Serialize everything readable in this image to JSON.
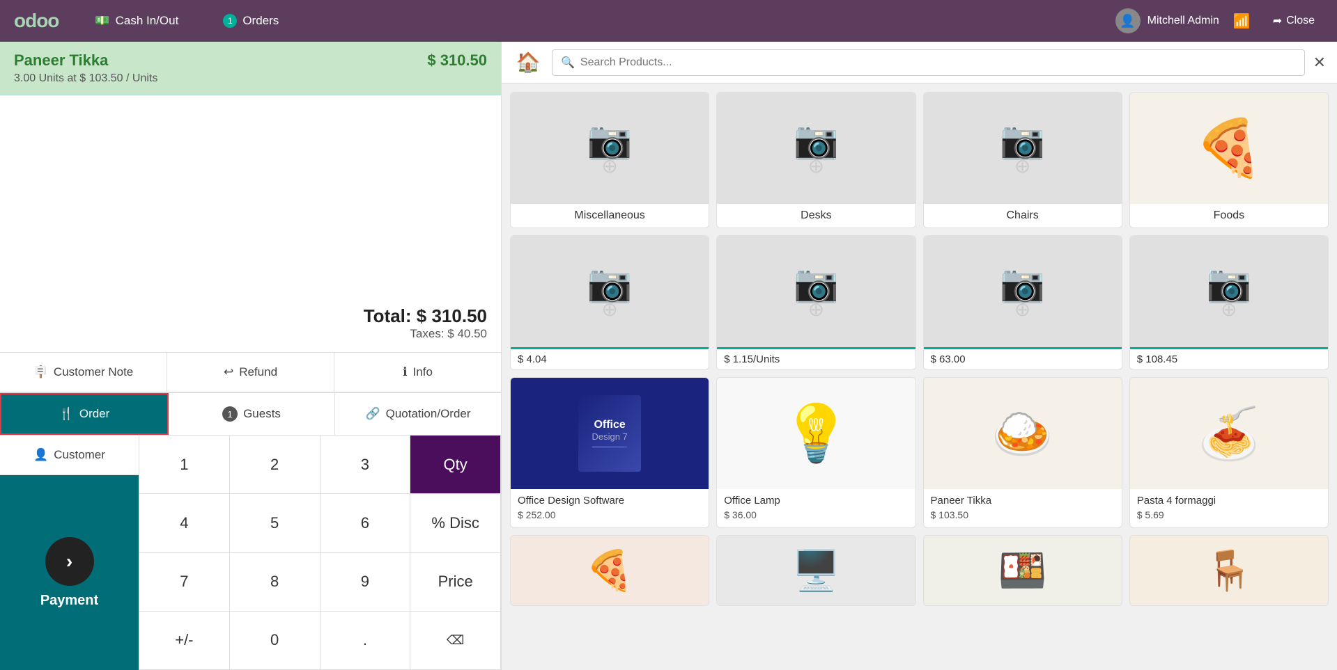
{
  "nav": {
    "logo": "odoo",
    "cash_in_out": "Cash In/Out",
    "orders": "Orders",
    "orders_badge": "1",
    "user": "Mitchell Admin",
    "close": "Close"
  },
  "order": {
    "item_name": "Paneer Tikka",
    "item_price": "$ 310.50",
    "item_detail": "3.00 Units at $ 103.50 / Units",
    "total_label": "Total: $ 310.50",
    "taxes_label": "Taxes: $ 40.50"
  },
  "action_buttons": [
    {
      "label": "Customer Note",
      "icon": "🪧"
    },
    {
      "label": "Refund",
      "icon": "↩"
    },
    {
      "label": "Info",
      "icon": "ℹ"
    }
  ],
  "order_actions": [
    {
      "label": "Order",
      "icon": "🍴",
      "active": true
    },
    {
      "label": "Guests",
      "icon": "1",
      "badge": true
    },
    {
      "label": "Quotation/Order",
      "icon": "🔗"
    }
  ],
  "customer_btn": "Customer",
  "payment_label": "Payment",
  "numpad": {
    "keys": [
      "1",
      "2",
      "3",
      "Qty",
      "4",
      "5",
      "6",
      "% Disc",
      "7",
      "8",
      "9",
      "Price",
      "+/-",
      "0",
      ".",
      "⌫"
    ],
    "active": "Qty"
  },
  "search": {
    "placeholder": "Search Products...",
    "home_icon": "🏠"
  },
  "categories": [
    {
      "name": "Miscellaneous",
      "has_image": false
    },
    {
      "name": "Desks",
      "has_image": false
    },
    {
      "name": "Chairs",
      "has_image": false
    },
    {
      "name": "Foods",
      "has_image": true,
      "emoji": "🍕"
    }
  ],
  "products_row2": [
    {
      "name": "",
      "price": "$ 4.04",
      "has_image": false
    },
    {
      "name": "",
      "price": "$ 1.15/Units",
      "has_image": false
    },
    {
      "name": "",
      "price": "$ 63.00",
      "has_image": false
    },
    {
      "name": "",
      "price": "$ 108.45",
      "has_image": false
    }
  ],
  "products": [
    {
      "name": "Office Design Software",
      "price": "$ 252.00",
      "type": "software"
    },
    {
      "name": "Office Lamp",
      "price": "$ 36.00",
      "type": "lamp"
    },
    {
      "name": "Paneer Tikka",
      "price": "$ 103.50",
      "type": "text_only"
    },
    {
      "name": "Pasta 4 formaggi",
      "price": "$ 5.69",
      "type": "pasta"
    }
  ],
  "products_row4": [
    {
      "name": "",
      "price": "",
      "type": "pizza_slice"
    },
    {
      "name": "",
      "price": "",
      "type": "electronic_box"
    },
    {
      "name": "",
      "price": "",
      "type": "sushi"
    },
    {
      "name": "",
      "price": "",
      "type": "chair_img"
    }
  ]
}
